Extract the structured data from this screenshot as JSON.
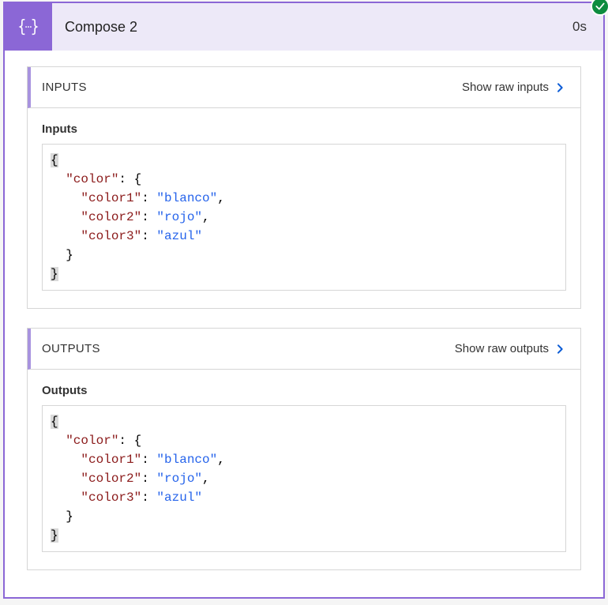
{
  "header": {
    "title": "Compose 2",
    "duration": "0s",
    "status_icon": "success-check"
  },
  "sections": {
    "inputs": {
      "header_label": "INPUTS",
      "show_raw_label": "Show raw inputs",
      "subtitle": "Inputs",
      "json": {
        "color": {
          "color1": "blanco",
          "color2": "rojo",
          "color3": "azul"
        }
      }
    },
    "outputs": {
      "header_label": "OUTPUTS",
      "show_raw_label": "Show raw outputs",
      "subtitle": "Outputs",
      "json": {
        "color": {
          "color1": "blanco",
          "color2": "rojo",
          "color3": "azul"
        }
      }
    }
  }
}
